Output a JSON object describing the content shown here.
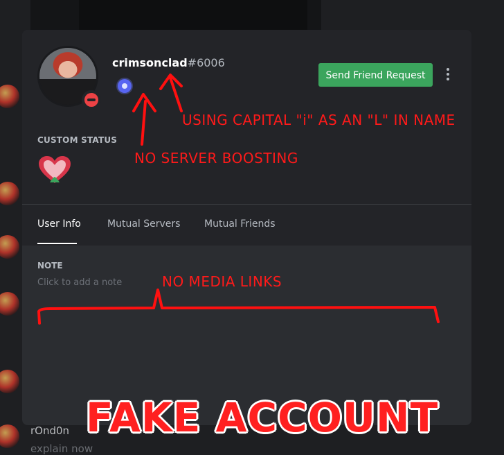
{
  "profile": {
    "username": "crimsonclad",
    "discriminator": "#6006",
    "send_friend_request_label": "Send Friend Request",
    "custom_status_label": "CUSTOM STATUS",
    "status": "do-not-disturb"
  },
  "tabs": [
    {
      "label": "User Info",
      "active": true
    },
    {
      "label": "Mutual Servers",
      "active": false
    },
    {
      "label": "Mutual Friends",
      "active": false
    }
  ],
  "note": {
    "label": "NOTE",
    "placeholder": "Click to add a note"
  },
  "annotations": {
    "capital_i": "USING CAPITAL \"i\" AS AN \"L\" IN NAME",
    "no_boost": "NO SERVER BOOSTING",
    "no_media": "NO MEDIA LINKS",
    "fake": "FAKE ACCOUNT"
  },
  "background_message": {
    "author": "rOnd0n",
    "text": "explain now"
  },
  "colors": {
    "modal_bg": "#2b2d31",
    "header_bg": "#232428",
    "button_green": "#3ba55d",
    "dnd_red": "#ed4245",
    "annotation_red": "#ff1a1a"
  },
  "icons": [
    "avatar",
    "dnd-status-icon",
    "nitro-badge-icon",
    "more-options-icon",
    "heart-emoji-icon"
  ]
}
